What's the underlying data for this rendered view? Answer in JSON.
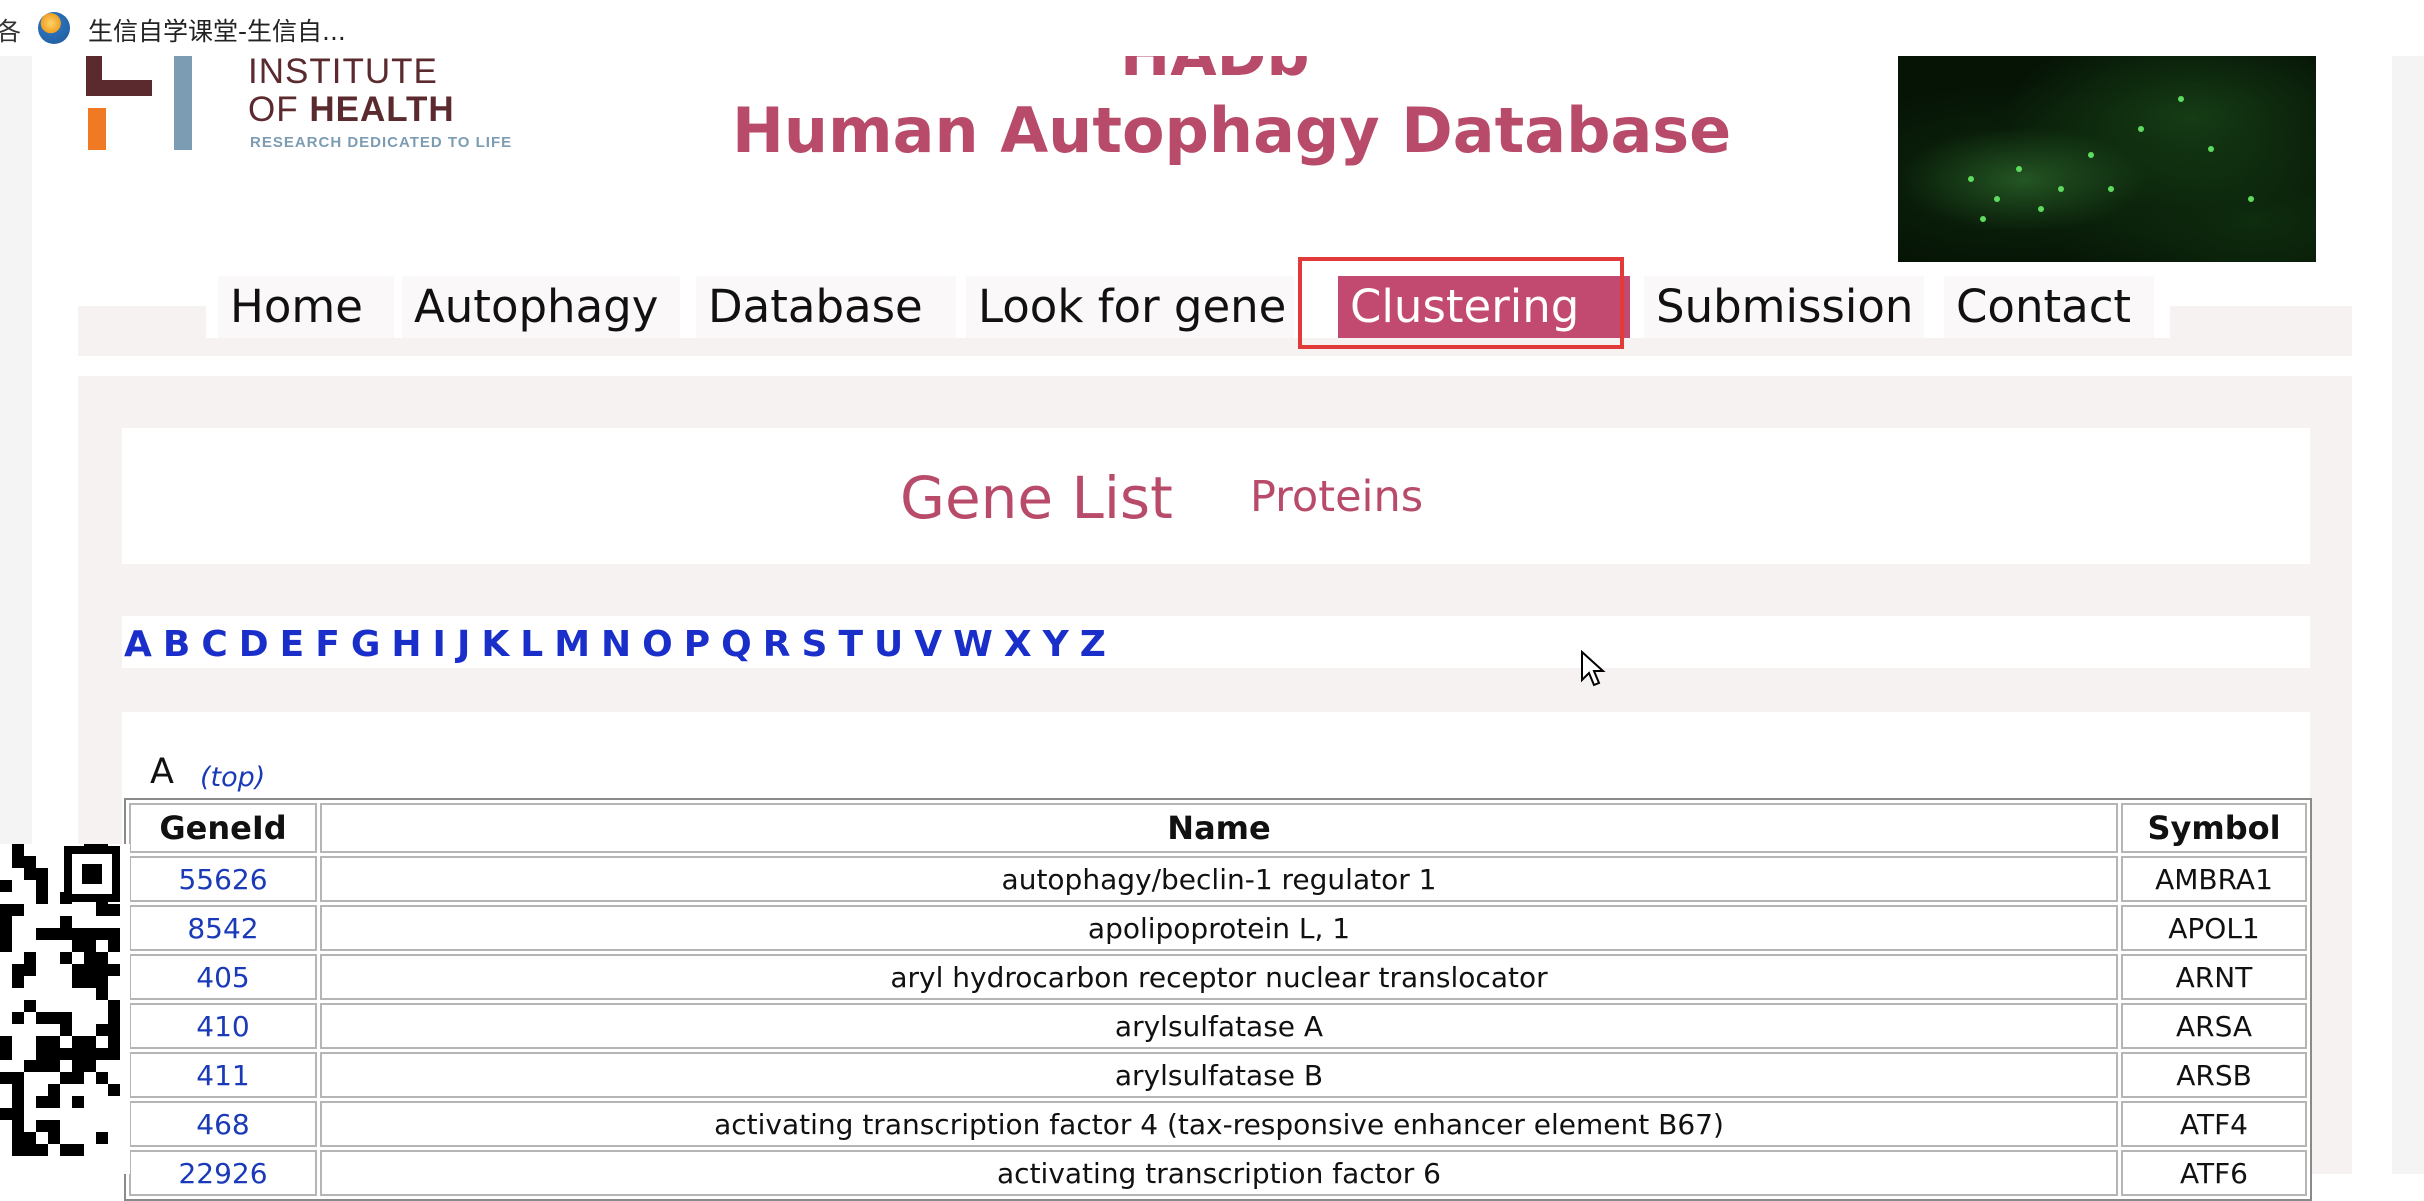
{
  "browser": {
    "bookmark_title": "生信自学课堂-生信自..."
  },
  "header": {
    "logo_line1": "INSTITUTE",
    "logo_line2_prefix": "OF",
    "logo_line2_bold": "HEALTH",
    "logo_tagline": "RESEARCH DEDICATED TO LIFE",
    "short_title": "HADb",
    "title": "Human Autophagy Database"
  },
  "nav": {
    "items": [
      {
        "label": "Home"
      },
      {
        "label": "Autophagy"
      },
      {
        "label": "Database"
      },
      {
        "label": "Look for gene"
      },
      {
        "label": "Clustering"
      },
      {
        "label": "Submission"
      },
      {
        "label": "Contact"
      }
    ],
    "active": "Clustering",
    "active_color": "#c2496f",
    "highlight_color": "#e23a3a"
  },
  "content": {
    "title": "Gene List",
    "proteins_link": "Proteins",
    "alphabet": [
      "A",
      "B",
      "C",
      "D",
      "E",
      "F",
      "G",
      "H",
      "I",
      "J",
      "K",
      "L",
      "M",
      "N",
      "O",
      "P",
      "Q",
      "R",
      "S",
      "T",
      "U",
      "V",
      "W",
      "X",
      "Y",
      "Z"
    ],
    "section_letter": "A",
    "top_link": "(top)"
  },
  "table": {
    "headers": {
      "id": "GeneId",
      "name": "Name",
      "symbol": "Symbol"
    },
    "rows": [
      {
        "id": "55626",
        "name": "autophagy/beclin-1 regulator 1",
        "symbol": "AMBRA1"
      },
      {
        "id": "8542",
        "name": "apolipoprotein L, 1",
        "symbol": "APOL1"
      },
      {
        "id": "405",
        "name": "aryl hydrocarbon receptor nuclear translocator",
        "symbol": "ARNT"
      },
      {
        "id": "410",
        "name": "arylsulfatase A",
        "symbol": "ARSA"
      },
      {
        "id": "411",
        "name": "arylsulfatase B",
        "symbol": "ARSB"
      },
      {
        "id": "468",
        "name": "activating transcription factor 4 (tax-responsive enhancer element B67)",
        "symbol": "ATF4"
      },
      {
        "id": "22926",
        "name": "activating transcription factor 6",
        "symbol": "ATF6"
      }
    ]
  }
}
